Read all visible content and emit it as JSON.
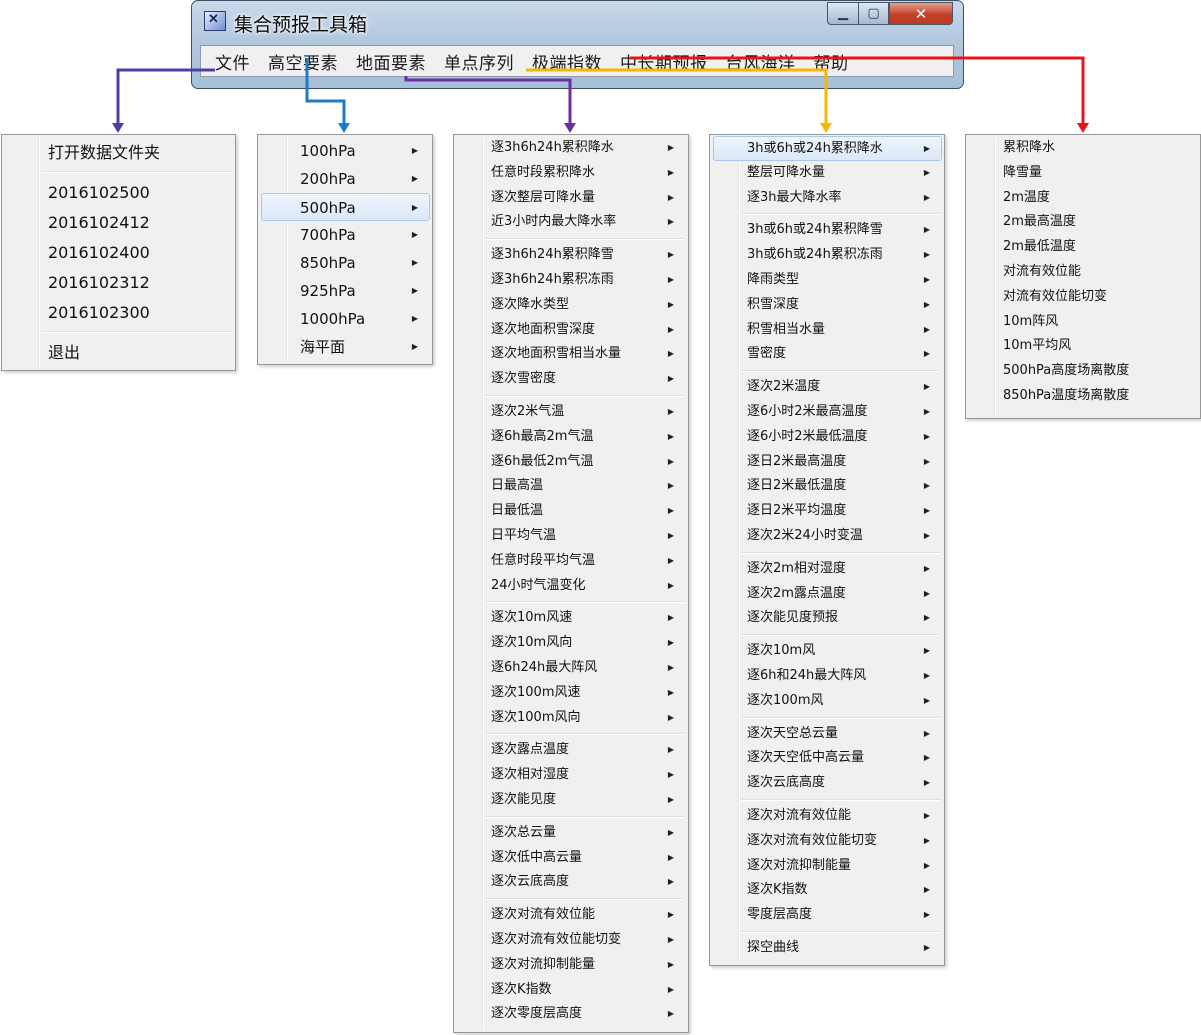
{
  "window": {
    "title": "集合预报工具箱",
    "icon_name": "app-icon",
    "controls": {
      "minimize": "minimize-icon",
      "maximize": "maximize-icon",
      "close": "close-icon"
    }
  },
  "menubar": {
    "items": [
      {
        "label": "文件",
        "color": "#4B3FA6"
      },
      {
        "label": "高空要素",
        "color": "#1E7BC4"
      },
      {
        "label": "地面要素",
        "color": "#6A2FA0"
      },
      {
        "label": "单点序列",
        "color": ""
      },
      {
        "label": "极端指数",
        "color": "#F5B800"
      },
      {
        "label": "中长期预报",
        "color": ""
      },
      {
        "label": "台风海洋",
        "color": ""
      },
      {
        "label": "帮助",
        "color": "#E8141B"
      }
    ]
  },
  "menus": {
    "file": {
      "open": "打开数据文件夹",
      "recent": [
        "2016102500",
        "2016102412",
        "2016102400",
        "2016102312",
        "2016102300"
      ],
      "exit": "退出"
    },
    "upper": {
      "items": [
        "100hPa",
        "200hPa",
        "500hPa",
        "700hPa",
        "850hPa",
        "925hPa",
        "1000hPa",
        "海平面"
      ],
      "highlighted": "500hPa"
    },
    "surface": {
      "groups": [
        [
          "逐3h6h24h累积降水",
          "任意时段累积降水",
          "逐次整层可降水量",
          "近3小时内最大降水率"
        ],
        [
          "逐3h6h24h累积降雪",
          "逐3h6h24h累积冻雨",
          "逐次降水类型",
          "逐次地面积雪深度",
          "逐次地面积雪相当水量",
          "逐次雪密度"
        ],
        [
          "逐次2米气温",
          "逐6h最高2m气温",
          "逐6h最低2m气温",
          "日最高温",
          "日最低温",
          "日平均气温",
          "任意时段平均气温",
          "24小时气温变化"
        ],
        [
          "逐次10m风速",
          "逐次10m风向",
          "逐6h24h最大阵风",
          "逐次100m风速",
          "逐次100m风向"
        ],
        [
          "逐次露点温度",
          "逐次相对湿度",
          "逐次能见度"
        ],
        [
          "逐次总云量",
          "逐次低中高云量",
          "逐次云底高度"
        ],
        [
          "逐次对流有效位能",
          "逐次对流有效位能切变",
          "逐次对流抑制能量",
          "逐次K指数",
          "逐次零度层高度"
        ]
      ]
    },
    "extreme": {
      "highlighted": "3h或6h或24h累积降水",
      "groups": [
        [
          "3h或6h或24h累积降水",
          "整层可降水量",
          "逐3h最大降水率"
        ],
        [
          "3h或6h或24h累积降雪",
          "3h或6h或24h累积冻雨",
          "降雨类型",
          "积雪深度",
          "积雪相当水量",
          "雪密度"
        ],
        [
          "逐次2米温度",
          "逐6小时2米最高温度",
          "逐6小时2米最低温度",
          "逐日2米最高温度",
          "逐日2米最低温度",
          "逐日2米平均温度",
          "逐次2米24小时变温"
        ],
        [
          "逐次2m相对湿度",
          "逐次2m露点温度",
          "逐次能见度预报"
        ],
        [
          "逐次10m风",
          "逐6h和24h最大阵风",
          "逐次100m风"
        ],
        [
          "逐次天空总云量",
          "逐次天空低中高云量",
          "逐次云底高度"
        ],
        [
          "逐次对流有效位能",
          "逐次对流有效位能切变",
          "逐次对流抑制能量",
          "逐次K指数",
          "零度层高度"
        ],
        [
          "探空曲线"
        ]
      ]
    },
    "help": {
      "items": [
        "累积降水",
        "降雪量",
        "2m温度",
        "2m最高温度",
        "2m最低温度",
        "对流有效位能",
        "对流有效位能切变",
        "10m阵风",
        "10m平均风",
        "500hPa高度场离散度",
        "850hPa温度场离散度"
      ]
    }
  }
}
